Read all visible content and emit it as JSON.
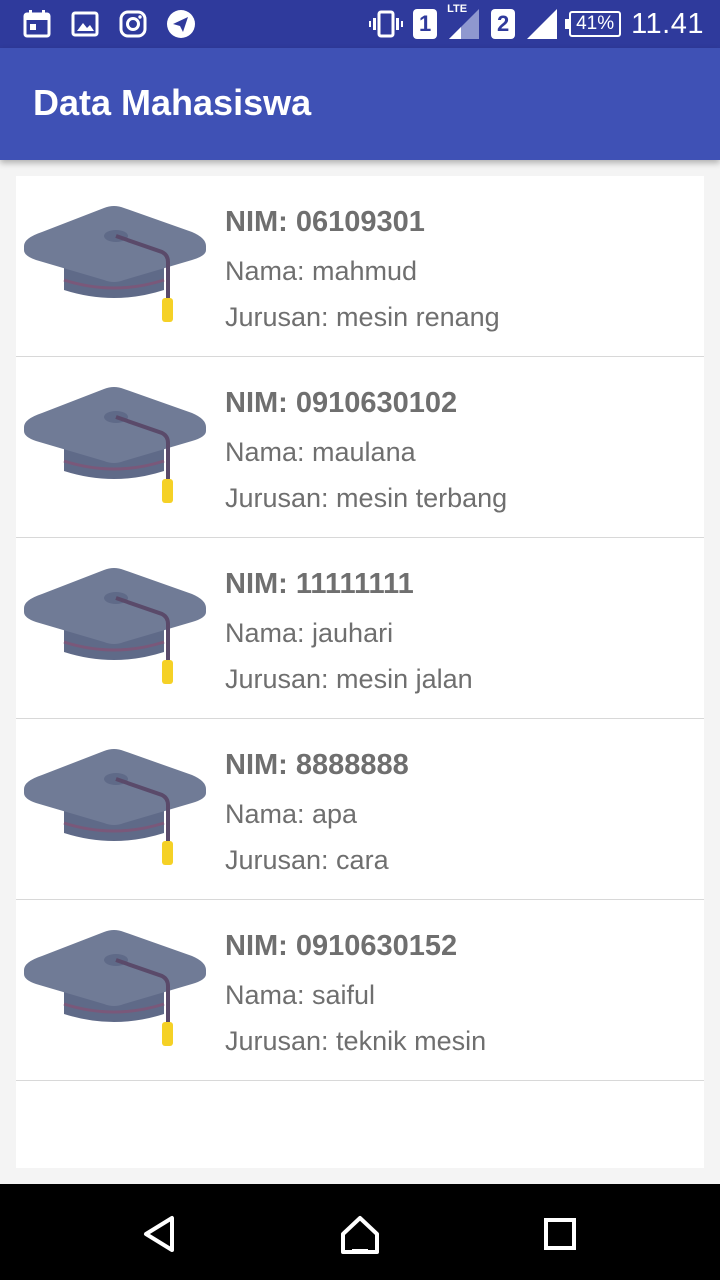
{
  "status_bar": {
    "sim1": "1",
    "sim2": "2",
    "network_label": "LTE",
    "battery": "41%",
    "time": "11.41",
    "icons": [
      "calendar-icon",
      "gallery-icon",
      "instagram-icon",
      "telegram-icon",
      "vibrate-icon",
      "signal-icon",
      "battery-icon"
    ]
  },
  "app_bar": {
    "title": "Data Mahasiswa",
    "color": "#3f51b5"
  },
  "students": [
    {
      "nim": "NIM: 06109301",
      "nama": "Nama: mahmud",
      "jurusan": "Jurusan: mesin renang"
    },
    {
      "nim": "NIM: 0910630102",
      "nama": "Nama: maulana",
      "jurusan": "Jurusan: mesin terbang"
    },
    {
      "nim": "NIM: 11111111",
      "nama": "Nama: jauhari",
      "jurusan": "Jurusan: mesin jalan"
    },
    {
      "nim": "NIM: 8888888",
      "nama": "Nama: apa",
      "jurusan": "Jurusan: cara"
    },
    {
      "nim": "NIM: 0910630152",
      "nama": "Nama: saiful",
      "jurusan": "Jurusan: teknik mesin"
    }
  ],
  "item_icon": "graduation-cap-icon",
  "nav": [
    "back-icon",
    "home-icon",
    "recents-icon"
  ]
}
